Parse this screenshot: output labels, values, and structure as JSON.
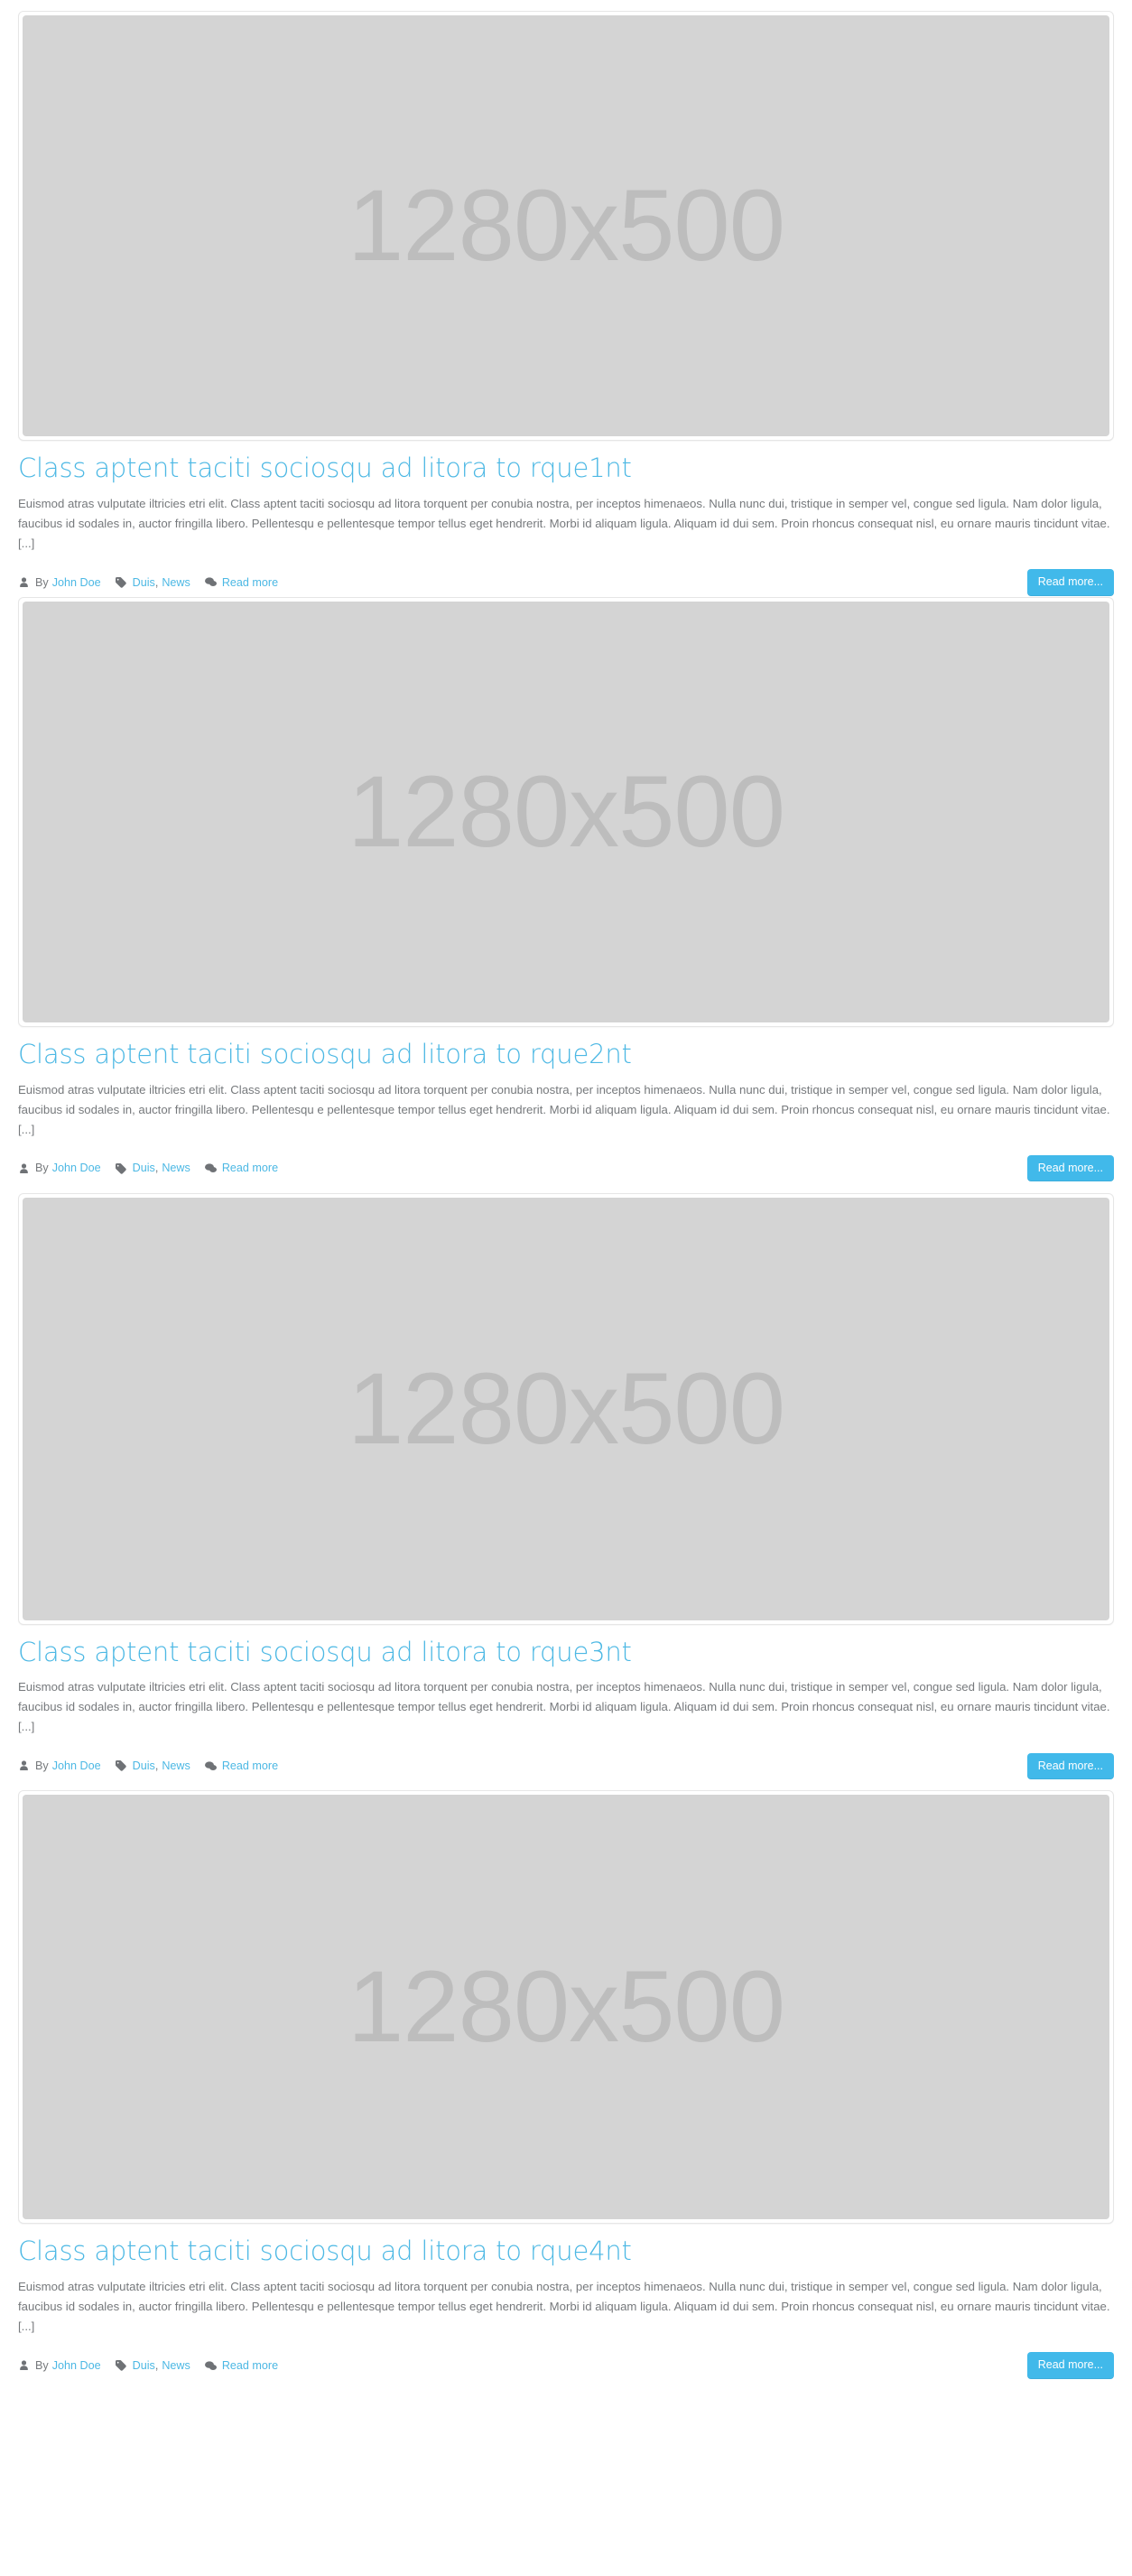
{
  "placeholder": {
    "dimensions_label": "1280x500",
    "bg_color": "#d4d4d4",
    "text_color": "#bdbdbd"
  },
  "theme": {
    "accent_color": "#4cb8e4",
    "button_color": "#41b9ea",
    "body_text_color": "#76797c"
  },
  "meta_common": {
    "by_label": "By",
    "author": "John Doe",
    "tag_first": "Duis",
    "tag_sep": ",",
    "tag_second": "News",
    "comments_link": "Read more",
    "readmore_button": "Read more...",
    "author_icon": "user-icon",
    "tag_icon": "tag-icon",
    "comments_icon": "comments-icon"
  },
  "posts": [
    {
      "title": "Class aptent taciti sociosqu ad litora to rque1nt",
      "excerpt": "Euismod atras vulputate iltricies etri elit. Class aptent taciti sociosqu ad litora torquent per conubia nostra, per inceptos himenaeos. Nulla nunc dui, tristique in semper vel, congue sed ligula. Nam dolor ligula, faucibus id sodales in,  auctor fringilla libero. Pellentesqu e pellentesque tempor tellus eget hendrerit. Morbi id aliquam ligula. Aliquam id dui sem. Proin rhoncus consequat nisl, eu ornare mauris tincidunt vitae. [...]"
    },
    {
      "title": "Class aptent taciti sociosqu ad litora to rque2nt",
      "excerpt": "Euismod atras vulputate iltricies etri elit. Class aptent taciti sociosqu ad litora torquent per conubia nostra, per inceptos himenaeos. Nulla nunc dui, tristique in semper vel, congue sed ligula. Nam dolor ligula, faucibus id sodales in,  auctor fringilla libero. Pellentesqu e pellentesque tempor tellus eget hendrerit. Morbi id aliquam ligula. Aliquam id dui sem. Proin rhoncus consequat nisl, eu ornare mauris tincidunt vitae. [...]"
    },
    {
      "title": "Class aptent taciti sociosqu ad litora to rque3nt",
      "excerpt": "Euismod atras vulputate iltricies etri elit. Class aptent taciti sociosqu ad litora torquent per conubia nostra, per inceptos himenaeos. Nulla nunc dui, tristique in semper vel, congue sed ligula. Nam dolor ligula, faucibus id sodales in,  auctor fringilla libero. Pellentesqu e pellentesque tempor tellus eget hendrerit. Morbi id aliquam ligula. Aliquam id dui sem. Proin rhoncus consequat nisl, eu ornare mauris tincidunt vitae. [...]"
    },
    {
      "title": "Class aptent taciti sociosqu ad litora to rque4nt",
      "excerpt": "Euismod atras vulputate iltricies etri elit. Class aptent taciti sociosqu ad litora torquent per conubia nostra, per inceptos himenaeos. Nulla nunc dui, tristique in semper vel, congue sed ligula. Nam dolor ligula, faucibus id sodales in,  auctor fringilla libero. Pellentesqu e pellentesque tempor tellus eget hendrerit. Morbi id aliquam ligula. Aliquam id dui sem. Proin rhoncus consequat nisl, eu ornare mauris tincidunt vitae. [...]"
    }
  ]
}
